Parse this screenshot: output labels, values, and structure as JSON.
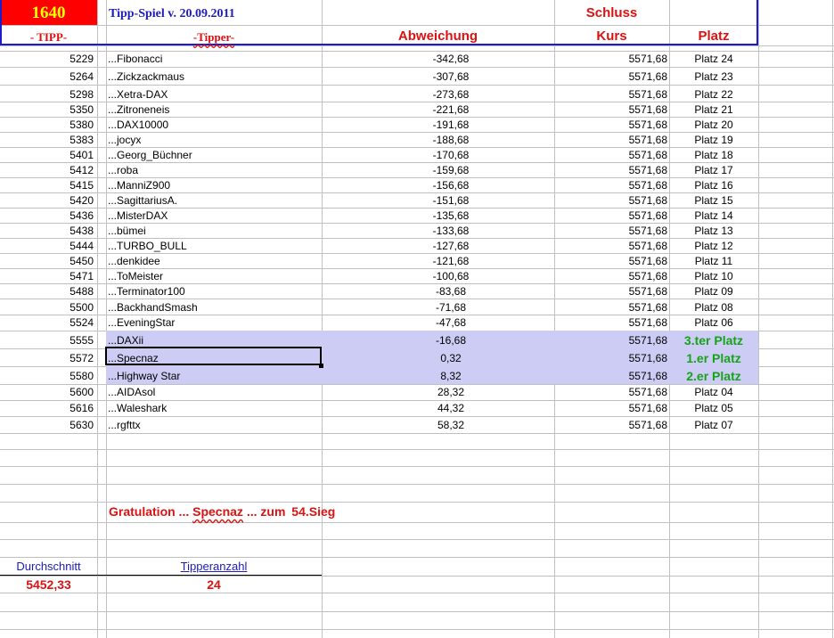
{
  "header": {
    "top_left_value": "1640",
    "game_title": "Tipp-Spiel v. 20.09.2011",
    "schluss_label": "Schluss",
    "col_tipp": "- TIPP-",
    "col_tipper": "-Tipper-",
    "col_abweichung": "Abweichung",
    "col_kurs": "Kurs",
    "col_platz": "Platz"
  },
  "rows": [
    {
      "tipp": "5229",
      "tipper": "...Fibonacci",
      "abw": "-342,68",
      "kurs": "5571,68",
      "platz": "Platz 24"
    },
    {
      "tipp": "5264",
      "tipper": "...Zickzackmaus",
      "abw": "-307,68",
      "kurs": "5571,68",
      "platz": "Platz 23"
    },
    {
      "tipp": "5298",
      "tipper": "...Xetra-DAX",
      "abw": "-273,68",
      "kurs": "5571,68",
      "platz": "Platz 22"
    },
    {
      "tipp": "5350",
      "tipper": "...Zitroneneis",
      "abw": "-221,68",
      "kurs": "5571,68",
      "platz": "Platz 21"
    },
    {
      "tipp": "5380",
      "tipper": "...DAX10000",
      "abw": "-191,68",
      "kurs": "5571,68",
      "platz": "Platz 20"
    },
    {
      "tipp": "5383",
      "tipper": "...jocyx",
      "abw": "-188,68",
      "kurs": "5571,68",
      "platz": "Platz 19"
    },
    {
      "tipp": "5401",
      "tipper": "...Georg_Büchner",
      "abw": "-170,68",
      "kurs": "5571,68",
      "platz": "Platz 18"
    },
    {
      "tipp": "5412",
      "tipper": "...roba",
      "abw": "-159,68",
      "kurs": "5571,68",
      "platz": "Platz 17"
    },
    {
      "tipp": "5415",
      "tipper": "...ManniZ900",
      "abw": "-156,68",
      "kurs": "5571,68",
      "platz": "Platz 16"
    },
    {
      "tipp": "5420",
      "tipper": "...SagittariusA.",
      "abw": "-151,68",
      "kurs": "5571,68",
      "platz": "Platz 15"
    },
    {
      "tipp": "5436",
      "tipper": "...MisterDAX",
      "abw": "-135,68",
      "kurs": "5571,68",
      "platz": "Platz 14"
    },
    {
      "tipp": "5438",
      "tipper": "...bümei",
      "abw": "-133,68",
      "kurs": "5571,68",
      "platz": "Platz 13"
    },
    {
      "tipp": "5444",
      "tipper": "...TURBO_BULL",
      "abw": "-127,68",
      "kurs": "5571,68",
      "platz": "Platz 12"
    },
    {
      "tipp": "5450",
      "tipper": "...denkidee",
      "abw": "-121,68",
      "kurs": "5571,68",
      "platz": "Platz 11"
    },
    {
      "tipp": "5471",
      "tipper": "...ToMeister",
      "abw": "-100,68",
      "kurs": "5571,68",
      "platz": "Platz 10"
    },
    {
      "tipp": "5488",
      "tipper": "...Terminator100",
      "abw": "-83,68",
      "kurs": "5571,68",
      "platz": "Platz 09"
    },
    {
      "tipp": "5500",
      "tipper": "...BackhandSmash",
      "abw": "-71,68",
      "kurs": "5571,68",
      "platz": "Platz 08"
    },
    {
      "tipp": "5524",
      "tipper": "...EveningStar",
      "abw": "-47,68",
      "kurs": "5571,68",
      "platz": "Platz 06"
    },
    {
      "tipp": "5555",
      "tipper": "...DAXii",
      "abw": "-16,68",
      "kurs": "5571,68",
      "platz": "3.ter Platz"
    },
    {
      "tipp": "5572",
      "tipper": "...Specnaz",
      "abw": "0,32",
      "kurs": "5571,68",
      "platz": "1.er Platz"
    },
    {
      "tipp": "5580",
      "tipper": "...Highway Star",
      "abw": "8,32",
      "kurs": "5571,68",
      "platz": "2.er Platz"
    },
    {
      "tipp": "5600",
      "tipper": "...AIDAsol",
      "abw": "28,32",
      "kurs": "5571,68",
      "platz": "Platz 04"
    },
    {
      "tipp": "5616",
      "tipper": "...Waleshark",
      "abw": "44,32",
      "kurs": "5571,68",
      "platz": "Platz 05"
    },
    {
      "tipp": "5630",
      "tipper": "...rgfttx",
      "abw": "58,32",
      "kurs": "5571,68",
      "platz": "Platz 07"
    }
  ],
  "congrats": {
    "prefix": "Gratulation ...",
    "name": "Specnaz",
    "middle": "... zum",
    "suffix": "54.Sieg"
  },
  "footer": {
    "durchschnitt_label": "Durchschnitt",
    "durchschnitt_value": "5452,33",
    "tipperanzahl_label": "Tipperanzahl",
    "tipperanzahl_value": "24"
  },
  "colors": {
    "header_red": "#ff0000",
    "title_yellow": "#ffff00",
    "header_border_blue": "#1c1ccc",
    "highlight_row": "#ccccf5",
    "accent_red": "#dd1111",
    "winner_green": "#17a317"
  }
}
